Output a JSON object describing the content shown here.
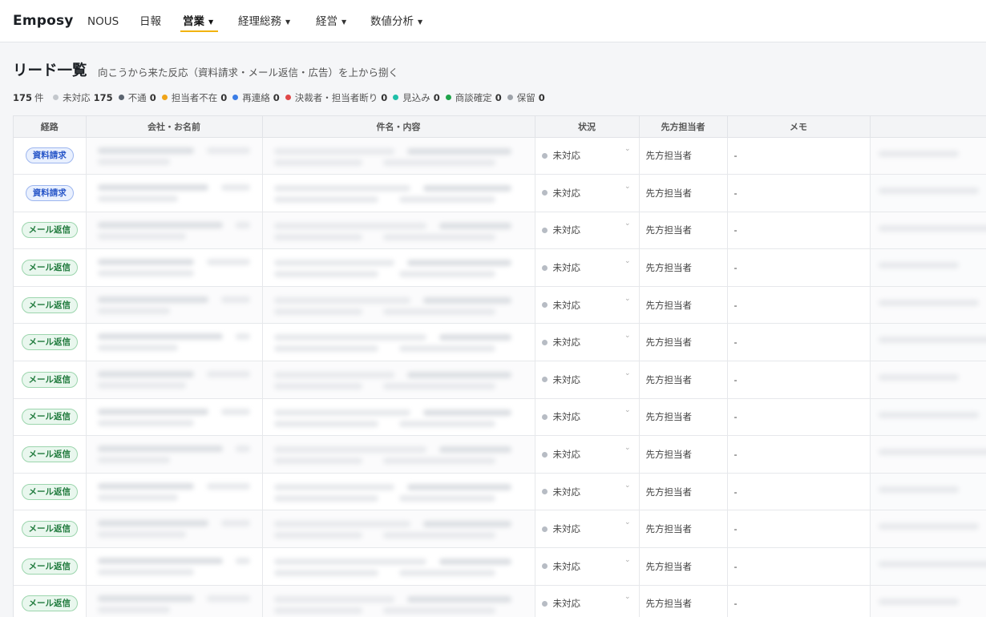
{
  "app": {
    "logo": "Emposy",
    "nav": [
      {
        "label": "NOUS",
        "dropdown": false,
        "active": false
      },
      {
        "label": "日報",
        "dropdown": false,
        "active": false
      },
      {
        "label": "営業",
        "dropdown": true,
        "active": true
      },
      {
        "label": "経理総務",
        "dropdown": true,
        "active": false
      },
      {
        "label": "経営",
        "dropdown": true,
        "active": false
      },
      {
        "label": "数値分析",
        "dropdown": true,
        "active": false
      }
    ],
    "accent_color": "#f2b30f"
  },
  "page": {
    "title": "リード一覧",
    "subtitle": "向こうから来た反応（資料請求・メール返信・広告）を上から捌く"
  },
  "summary": {
    "total": "175",
    "unit": "件",
    "stats": [
      {
        "label": "未対応",
        "count": "175",
        "color": "#c3c7cc"
      },
      {
        "label": "不通",
        "count": "0",
        "color": "#5b6470"
      },
      {
        "label": "担当者不在",
        "count": "0",
        "color": "#f0a418"
      },
      {
        "label": "再連絡",
        "count": "0",
        "color": "#3b7de6"
      },
      {
        "label": "決裁者・担当者断り",
        "count": "0",
        "color": "#e04848"
      },
      {
        "label": "見込み",
        "count": "0",
        "color": "#1fbfa8"
      },
      {
        "label": "商談確定",
        "count": "0",
        "color": "#1fa34a"
      },
      {
        "label": "保留",
        "count": "0",
        "color": "#9ea3aa"
      }
    ]
  },
  "table": {
    "columns": [
      "経路",
      "会社・お名前",
      "件名・内容",
      "状況",
      "先方担当者",
      "メモ"
    ],
    "rows": [
      {
        "source": "資料請求",
        "source_type": "blue",
        "status": "未対応",
        "person": "先方担当者",
        "memo": "-"
      },
      {
        "source": "資料請求",
        "source_type": "blue",
        "status": "未対応",
        "person": "先方担当者",
        "memo": "-"
      },
      {
        "source": "メール返信",
        "source_type": "green",
        "status": "未対応",
        "person": "先方担当者",
        "memo": "-"
      },
      {
        "source": "メール返信",
        "source_type": "green",
        "status": "未対応",
        "person": "先方担当者",
        "memo": "-"
      },
      {
        "source": "メール返信",
        "source_type": "green",
        "status": "未対応",
        "person": "先方担当者",
        "memo": "-"
      },
      {
        "source": "メール返信",
        "source_type": "green",
        "status": "未対応",
        "person": "先方担当者",
        "memo": "-"
      },
      {
        "source": "メール返信",
        "source_type": "green",
        "status": "未対応",
        "person": "先方担当者",
        "memo": "-"
      },
      {
        "source": "メール返信",
        "source_type": "green",
        "status": "未対応",
        "person": "先方担当者",
        "memo": "-"
      },
      {
        "source": "メール返信",
        "source_type": "green",
        "status": "未対応",
        "person": "先方担当者",
        "memo": "-"
      },
      {
        "source": "メール返信",
        "source_type": "green",
        "status": "未対応",
        "person": "先方担当者",
        "memo": "-"
      },
      {
        "source": "メール返信",
        "source_type": "green",
        "status": "未対応",
        "person": "先方担当者",
        "memo": "-"
      },
      {
        "source": "メール返信",
        "source_type": "green",
        "status": "未対応",
        "person": "先方担当者",
        "memo": "-"
      },
      {
        "source": "メール返信",
        "source_type": "green",
        "status": "未対応",
        "person": "先方担当者",
        "memo": "-"
      }
    ]
  }
}
